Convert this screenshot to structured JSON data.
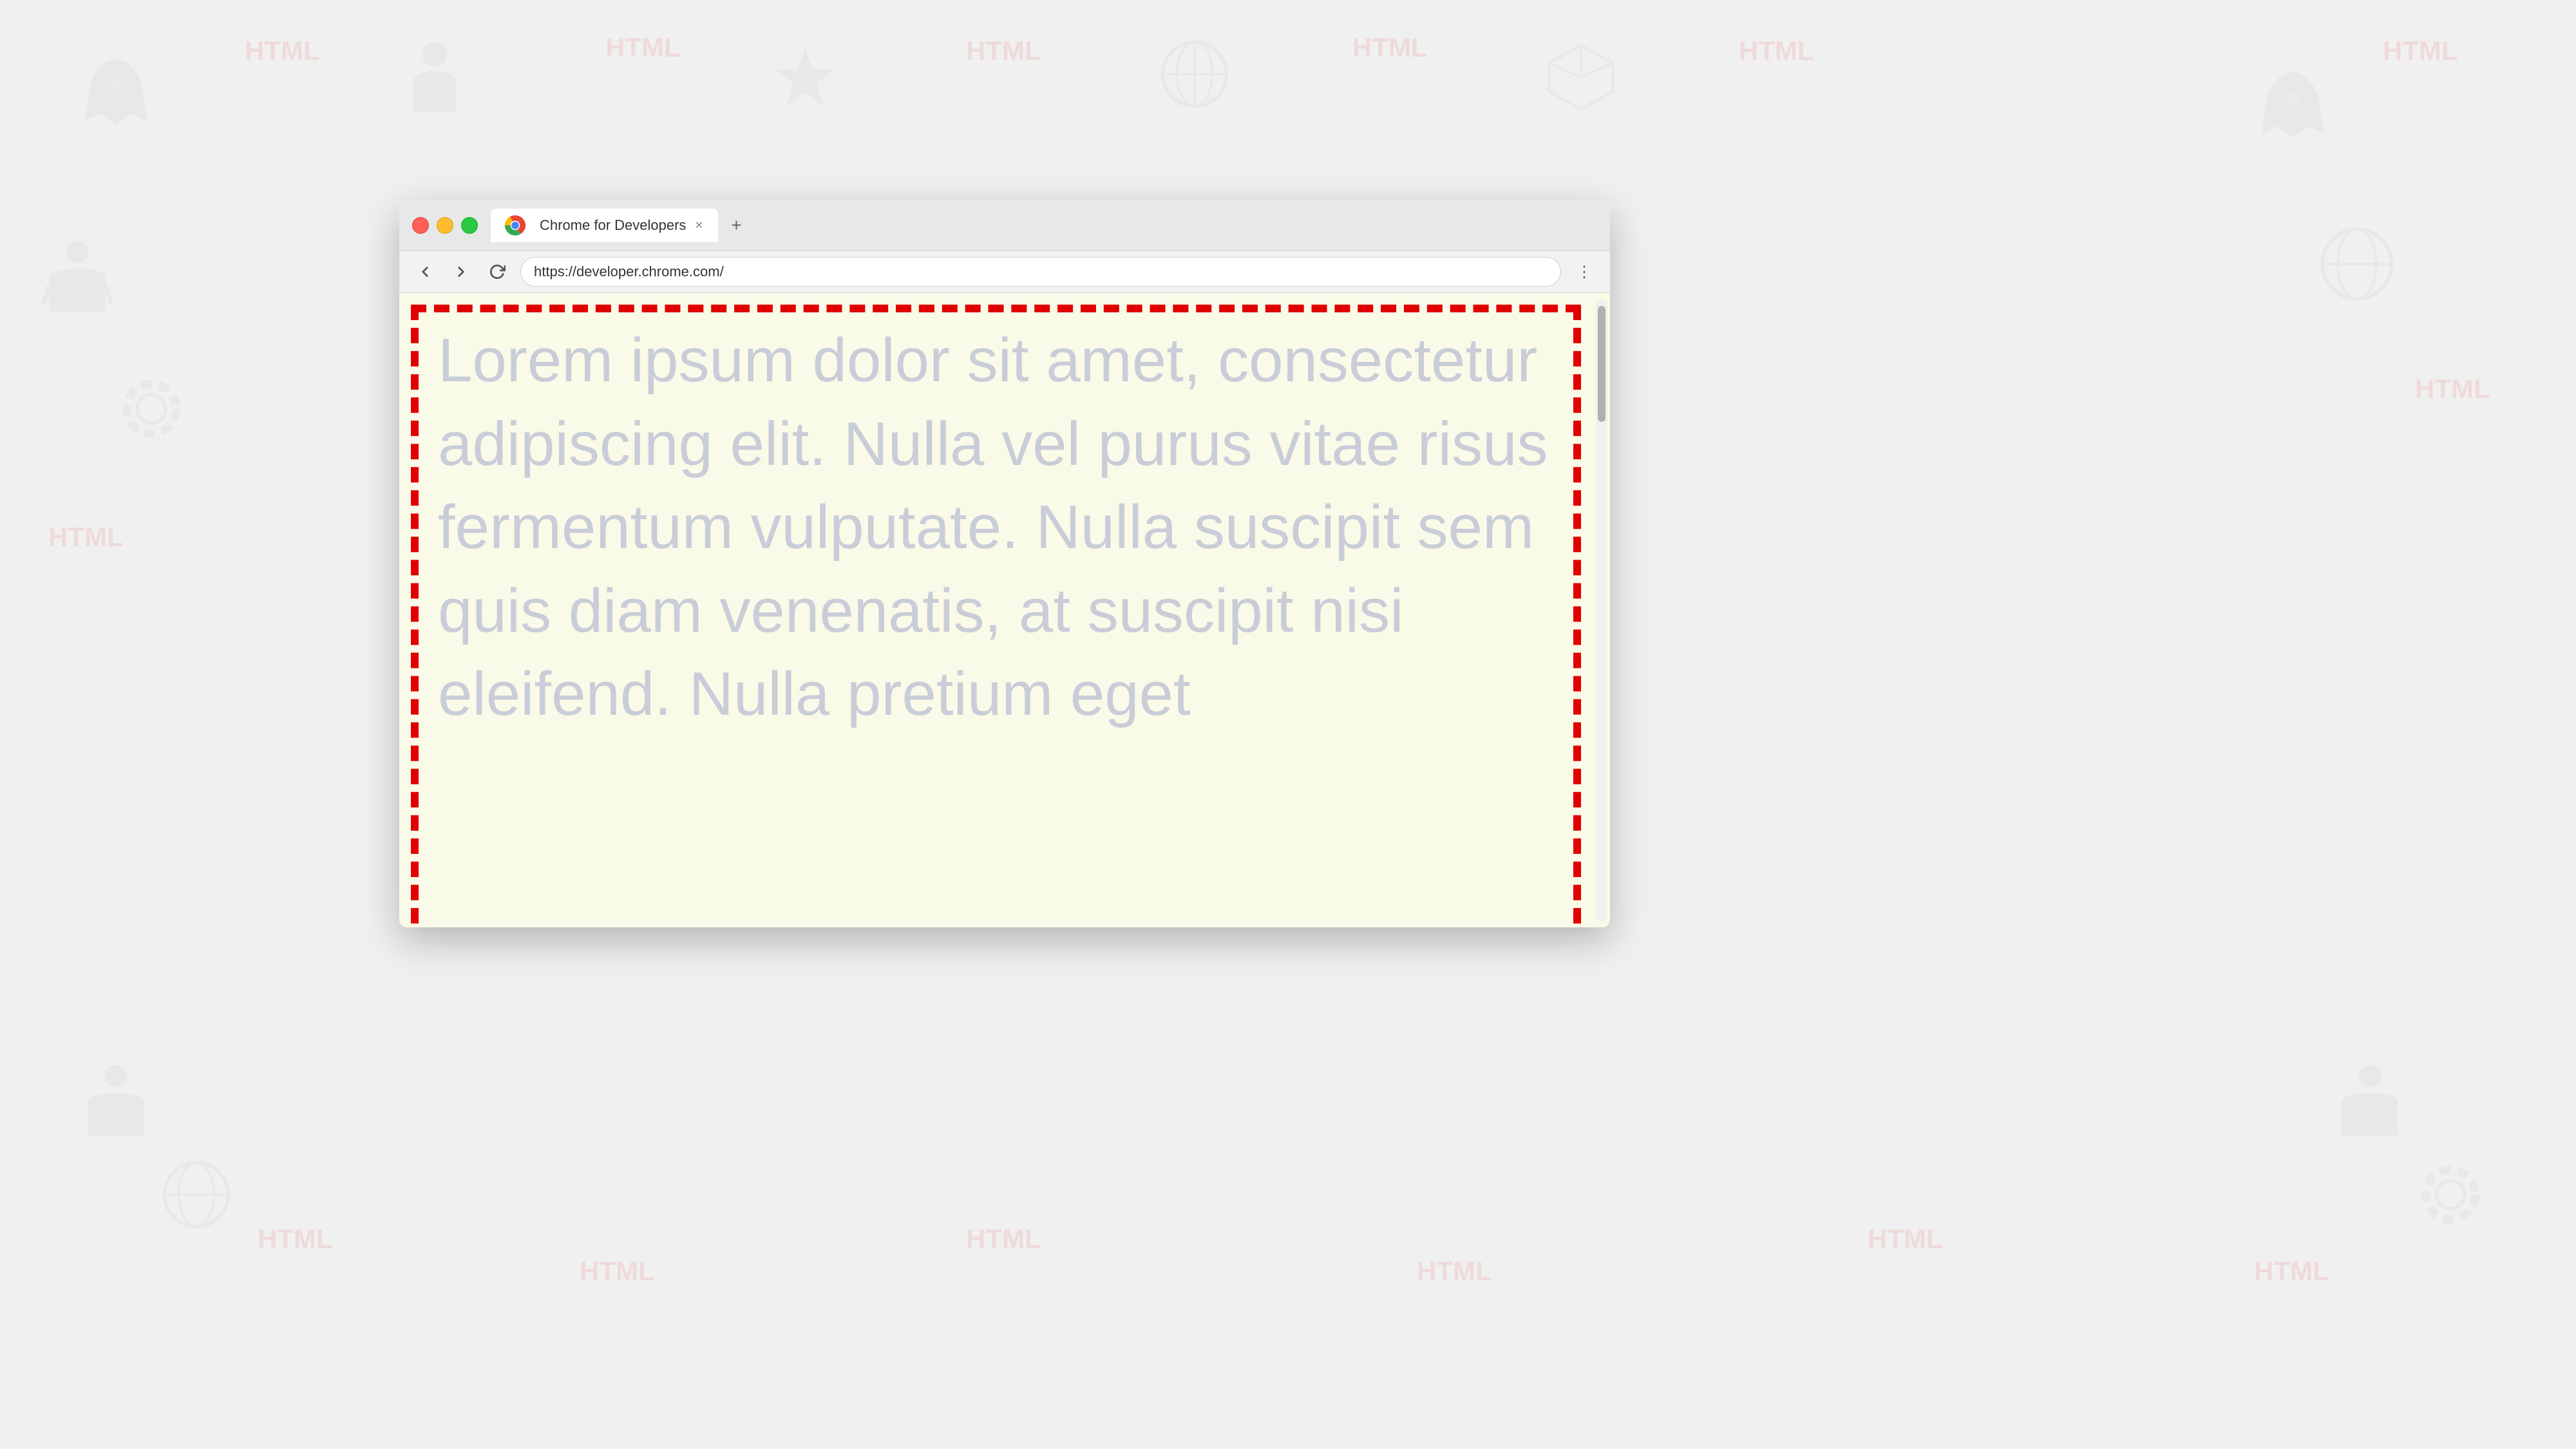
{
  "browser": {
    "title": "Chrome for Developers",
    "url": "https://developer.chrome.com/",
    "tab_label": "Chrome for Developers",
    "new_tab_symbol": "+",
    "traffic_lights": [
      "red",
      "yellow",
      "green"
    ],
    "menu_icon": "⋮"
  },
  "page": {
    "lorem_text": "Lorem ipsum dolor sit amet, consectetur adipiscing elit. Nulla vel purus vitae risus fermentum vulputate. Nulla suscipit sem quis diam venenatis, at suscipit nisi eleifend. Nulla pretium eget"
  },
  "background": {
    "html5_badges": [
      "HTML",
      "HTML",
      "HTML",
      "HTML",
      "HTML",
      "HTML",
      "HTML",
      "HTML",
      "HTML",
      "HTML",
      "HTML",
      "HTML"
    ]
  }
}
